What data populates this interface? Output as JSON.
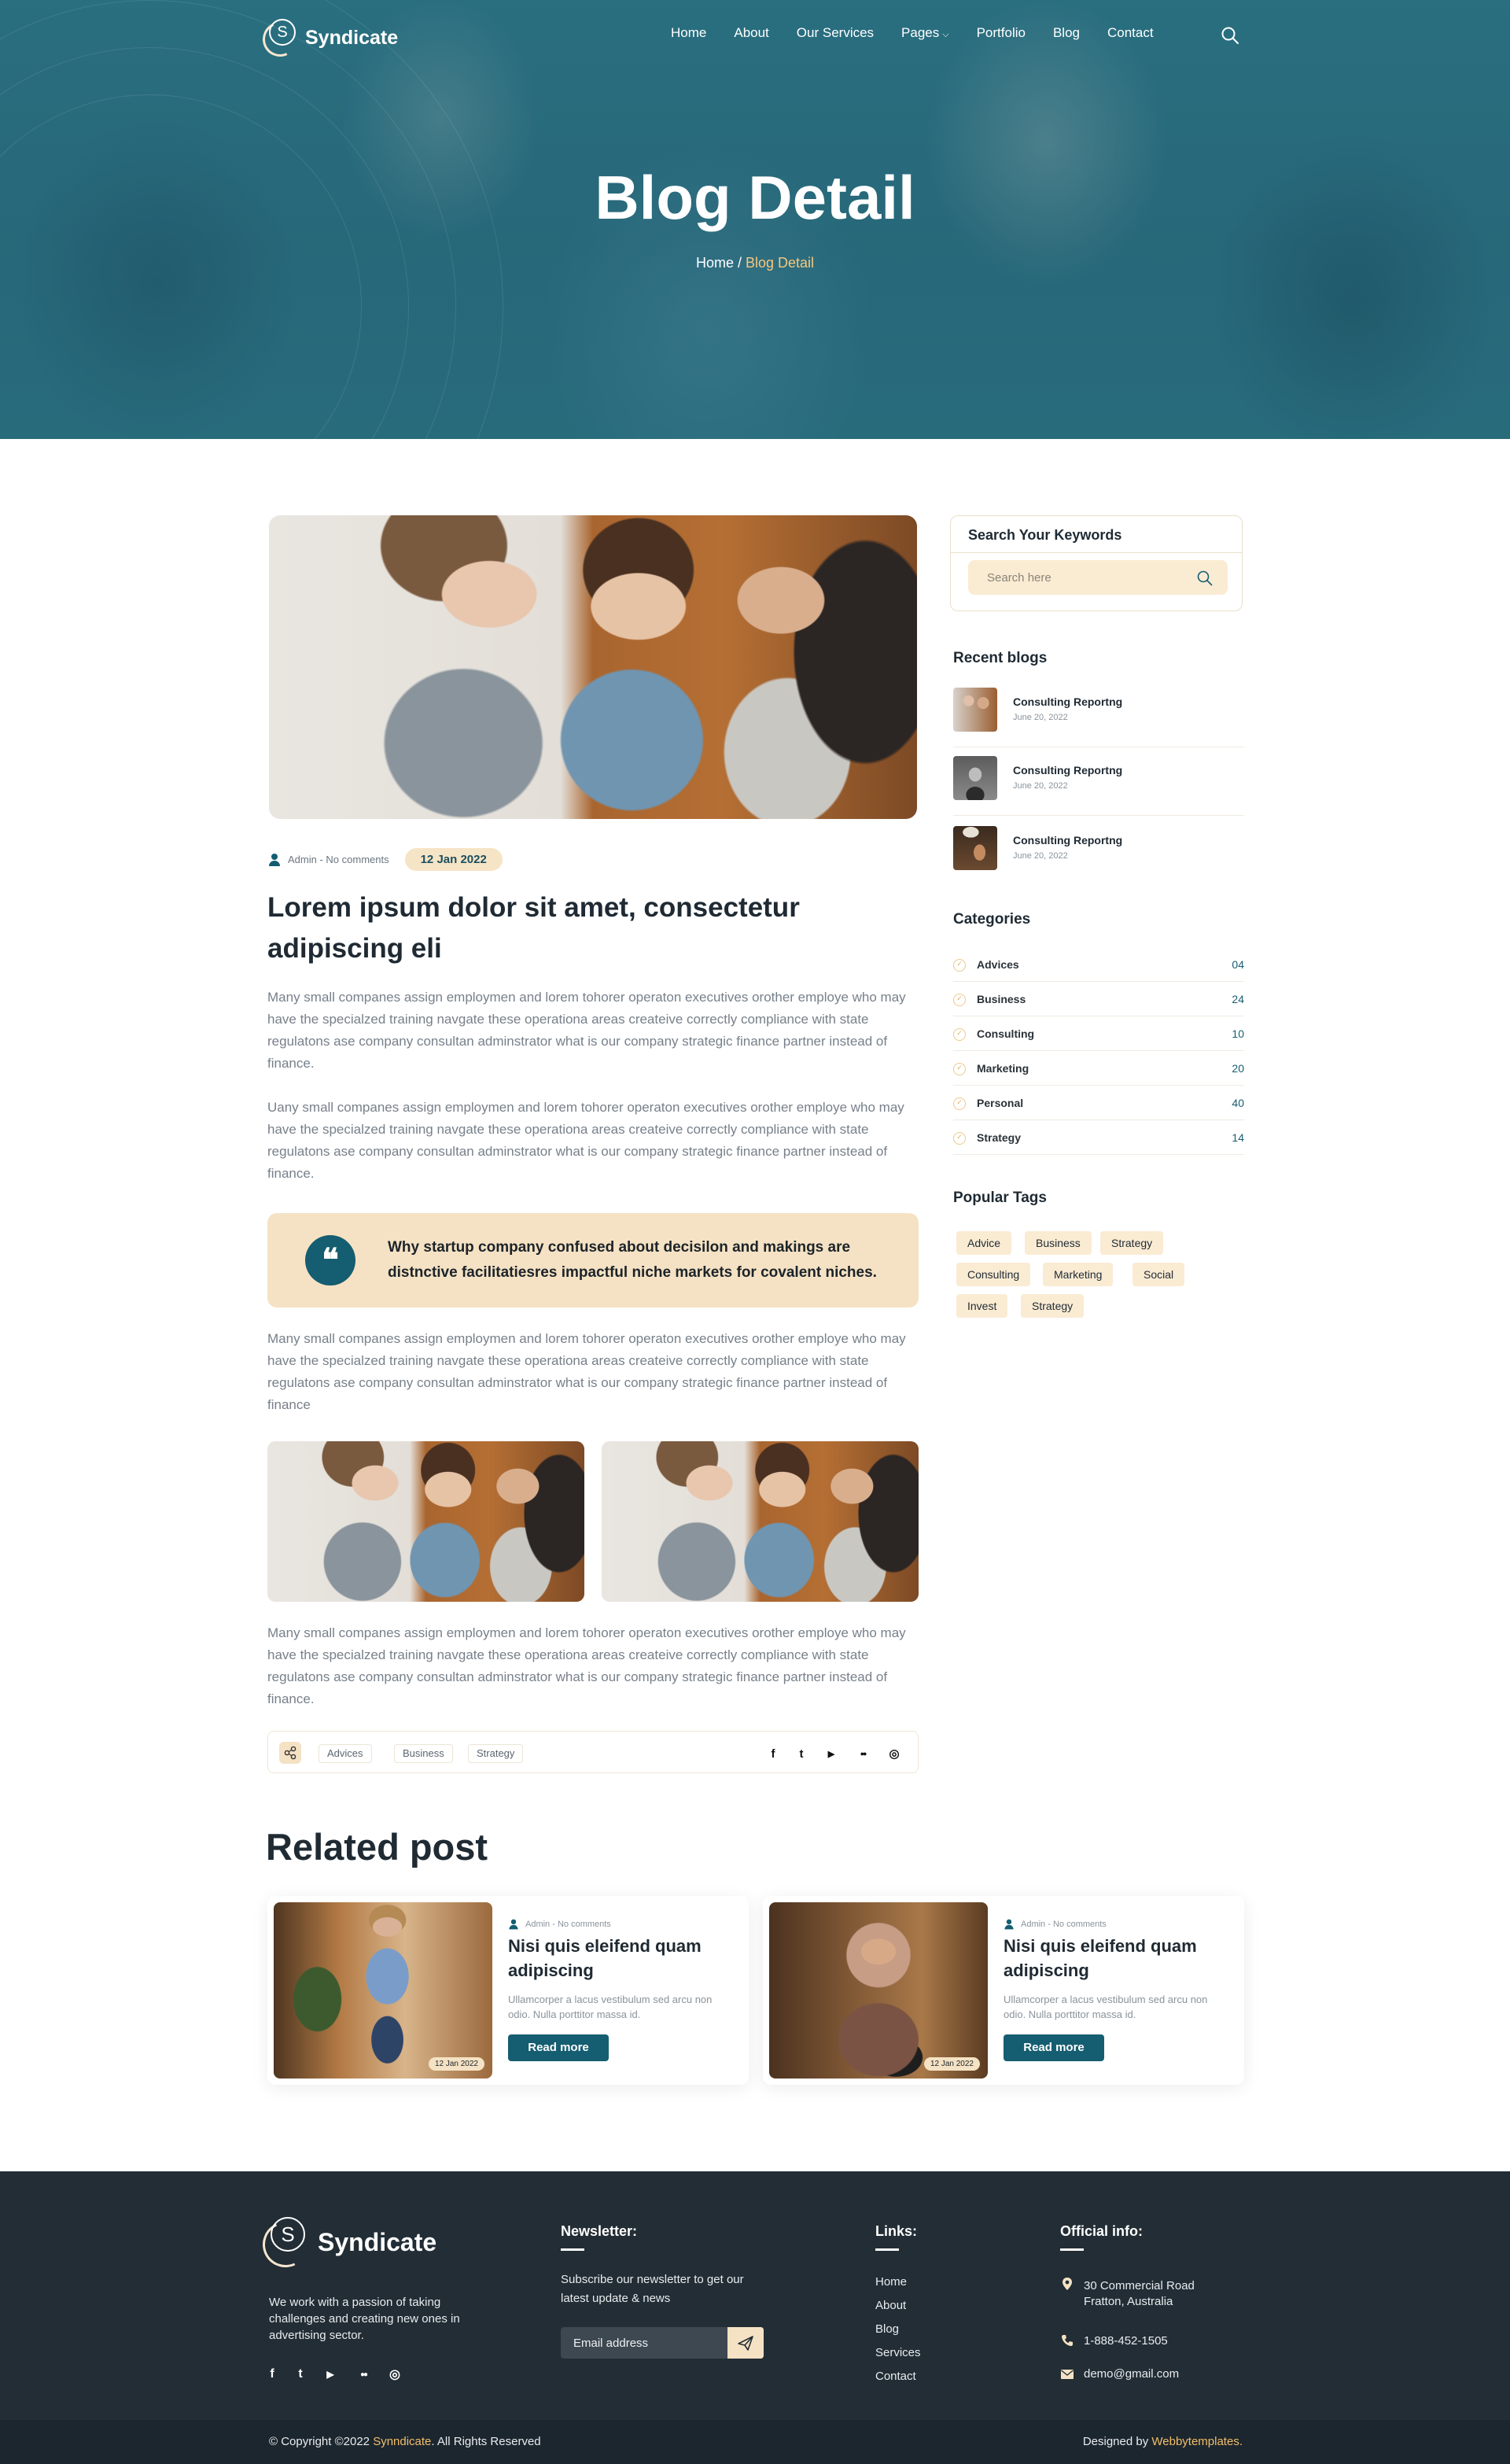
{
  "brand": {
    "name": "Syndicate",
    "logo_letter": "S"
  },
  "nav": {
    "items": [
      "Home",
      "About",
      "Our Services",
      "Pages",
      "Portfolio",
      "Blog",
      "Contact"
    ],
    "search_icon": "search-icon",
    "pages_caret": "chevron-down-icon"
  },
  "hero": {
    "title": "Blog Detail",
    "breadcrumb_home": "Home",
    "breadcrumb_sep": " / ",
    "breadcrumb_current": "Blog Detail"
  },
  "post": {
    "meta": "Admin - No comments",
    "date": "12 Jan 2022",
    "title": "Lorem ipsum dolor sit amet, consectetur adipiscing eli",
    "p1": "Many small companes assign employmen and lorem tohorer operaton executives orother employe who may have the specialzed training navgate these operationa areas createive correctly compliance with state regulatons ase company consultan adminstrator what is our company strategic finance partner instead of finance.",
    "p2": "Uany small companes assign employmen and lorem tohorer operaton executives orother employe who may have the specialzed training navgate these operationa areas createive correctly compliance with state regulatons ase company consultan adminstrator what is our company strategic finance partner instead of finance.",
    "quote": "Why startup company confused about decisilon and makings are distnctive facilitatiesres impactful niche markets for covalent niches.",
    "p3": "Many small companes assign employmen and lorem tohorer operaton executives orother employe who may have the specialzed training navgate these operationa areas createive correctly compliance with state regulatons ase company consultan adminstrator what is our company strategic finance partner instead of finance",
    "p4": "Many small companes assign employmen and lorem tohorer operaton executives orother employe who may have the specialzed training navgate these operationa areas createive correctly compliance with state regulatons ase company consultan adminstrator what is our company strategic finance partner instead of finance.",
    "tags": [
      "Advices",
      "Business",
      "Strategy"
    ],
    "social_icons": [
      "facebook-icon",
      "twitter-icon",
      "youtube-icon",
      "medium-icon",
      "instagram-icon"
    ],
    "social_glyphs": [
      "f",
      "t",
      "▶",
      "●●",
      "◎"
    ]
  },
  "related": {
    "title": "Related post",
    "cards": [
      {
        "meta": "Admin - No comments",
        "title": "Nisi quis eleifend quam adipiscing",
        "excerpt": "Ullamcorper a lacus vestibulum sed arcu non odio. Nulla porttitor massa id.",
        "button": "Read more",
        "date": "12 Jan 2022"
      },
      {
        "meta": "Admin - No comments",
        "title": "Nisi quis eleifend quam adipiscing",
        "excerpt": "Ullamcorper a lacus vestibulum sed arcu non odio. Nulla porttitor massa id.",
        "button": "Read more",
        "date": "12 Jan 2022"
      }
    ]
  },
  "sidebar": {
    "search_heading": "Search Your Keywords",
    "search_placeholder": "Search here",
    "recent_heading": "Recent blogs",
    "recent": [
      {
        "title": "Consulting Reportng",
        "date": "June 20, 2022"
      },
      {
        "title": "Consulting Reportng",
        "date": "June 20, 2022"
      },
      {
        "title": "Consulting Reportng",
        "date": "June 20, 2022"
      }
    ],
    "categories_heading": "Categories",
    "categories": [
      {
        "name": "Advices",
        "count": "04"
      },
      {
        "name": "Business",
        "count": "24"
      },
      {
        "name": "Consulting",
        "count": "10"
      },
      {
        "name": "Marketing",
        "count": "20"
      },
      {
        "name": "Personal",
        "count": "40"
      },
      {
        "name": "Strategy",
        "count": "14"
      }
    ],
    "tags_heading": "Popular Tags",
    "tags": [
      "Advice",
      "Business",
      "Strategy",
      "Consulting",
      "Marketing",
      "Social",
      "Invest",
      "Strategy"
    ]
  },
  "footer": {
    "about": "We work with a passion of taking challenges and creating new ones in advertising sector.",
    "newsletter_heading": "Newsletter:",
    "newsletter_text": "Subscribe our newsletter to get our latest update & news",
    "email_placeholder": "Email address",
    "links_heading": "Links:",
    "links": [
      "Home",
      "About",
      "Blog",
      "Services",
      "Contact"
    ],
    "info_heading": "Official info:",
    "address": "30 Commercial Road Fratton, Australia",
    "phone": "1-888-452-1505",
    "email": "demo@gmail.com",
    "copy_prefix": "© Copyright ©2022 ",
    "copy_brand": "Synndicate",
    "copy_suffix": ". All Rights Reserved",
    "designed_prefix": "Designed by ",
    "designed_brand": "Webbytemplates."
  },
  "colors": {
    "primary": "#155d70",
    "accent": "#f5e2c4",
    "footer_bg": "#222d35",
    "highlight": "#f2be6b"
  }
}
